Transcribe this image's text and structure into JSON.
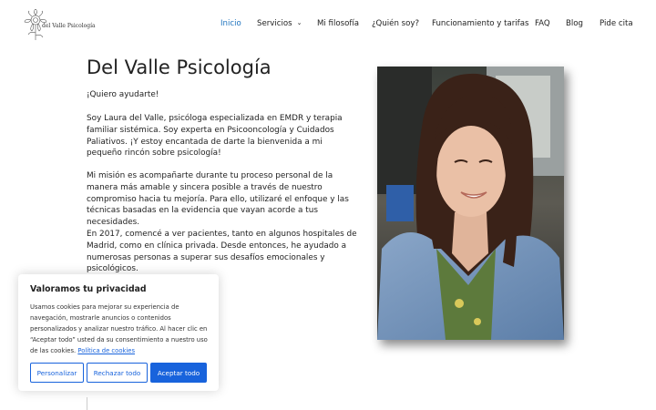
{
  "header": {
    "logo_text": "del Valle Psicología",
    "logo_icon": "botanical-flower-icon",
    "nav": [
      {
        "label": "Inicio",
        "active": true
      },
      {
        "label": "Servicios",
        "has_dropdown": true
      },
      {
        "label": "Mi filosofía"
      },
      {
        "label": "¿Quién soy?"
      },
      {
        "label": "Funcionamiento y tarifas"
      },
      {
        "label": "FAQ"
      },
      {
        "label": "Blog"
      },
      {
        "label": "Pide cita"
      }
    ],
    "dropdown_icon": "chevron-down-icon"
  },
  "main": {
    "title": "Del Valle Psicología",
    "greeting": "¡Quiero ayudarte!",
    "paragraphs": [
      "Soy Laura del Valle, psicóloga especializada en EMDR y terapia familiar sistémica. Soy experta en Psicooncología y Cuidados Paliativos. ¡Y estoy encantada de darte la bienvenida a mi pequeño rincón sobre psicología!",
      "Mi misión es acompañarte durante tu proceso personal de la manera más amable y sincera posible a través de nuestro compromiso hacia tu mejoría. Para ello, utilizaré el enfoque y las técnicas basadas en la evidencia que vayan acorde a tus necesidades.",
      "En 2017, comencé a ver pacientes, tanto en algunos hospitales de Madrid, como en clínica privada. Desde entonces, he ayudado a numerosas personas a superar sus desafíos emocionales y psicológicos."
    ]
  },
  "cookie_banner": {
    "title": "Valoramos tu privacidad",
    "text": "Usamos cookies para mejorar su experiencia de navegación, mostrarle anuncios o contenidos personalizados y analizar nuestro tráfico. Al hacer clic en “Aceptar todo” usted da su consentimiento a nuestro uso de las cookies.",
    "link": "Política de cookies",
    "buttons": {
      "customize": "Personalizar",
      "reject": "Rechazar todo",
      "accept": "Aceptar todo"
    }
  },
  "colors": {
    "accent": "#1e73be",
    "cookie_blue": "#1863dc",
    "text": "#222222"
  }
}
